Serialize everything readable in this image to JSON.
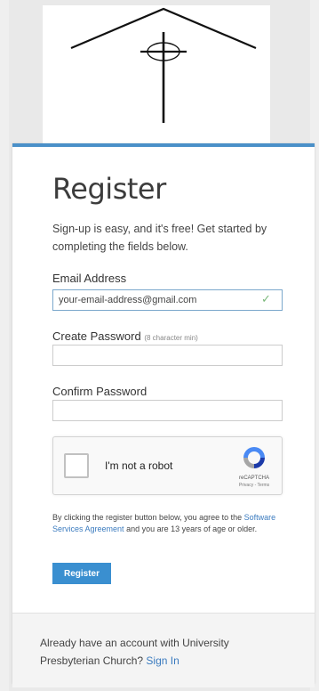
{
  "logo": {
    "name": "church-steeple-cross-logo"
  },
  "form": {
    "title": "Register",
    "subtitle": "Sign-up is easy, and it's free! Get started by completing the fields below.",
    "email": {
      "label": "Email Address",
      "value": "your-email-address@gmail.com",
      "valid_icon": "✓"
    },
    "password": {
      "label": "Create Password",
      "hint": "(8 character min)",
      "value": ""
    },
    "confirm": {
      "label": "Confirm Password",
      "value": ""
    },
    "captcha": {
      "label": "I'm not a robot",
      "brand": "reCAPTCHA",
      "links": "Privacy - Terms"
    },
    "legal": {
      "prefix": "By clicking the register button below, you agree to the",
      "link": "Software Services Agreement",
      "suffix": "and you are 13 years of age or older."
    },
    "register_button": "Register"
  },
  "footer": {
    "text": "Already have an account with University Presbyterian Church?",
    "signin_link": "Sign In"
  },
  "colors": {
    "accent": "#4a90c8",
    "button": "#3a8fd0",
    "link": "#3b7bbf"
  }
}
